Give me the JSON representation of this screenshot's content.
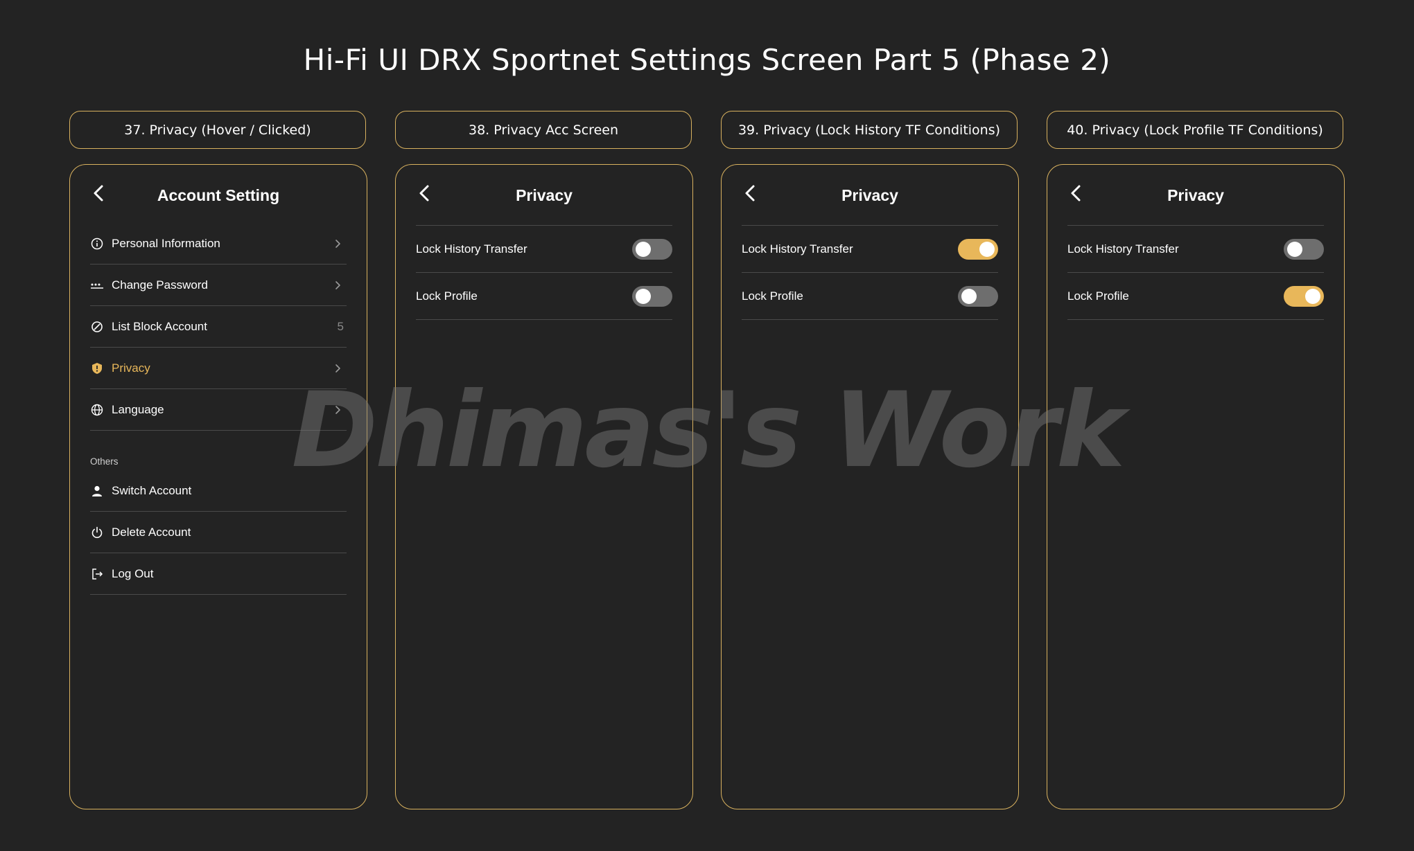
{
  "page_title": "Hi-Fi UI DRX Sportnet Settings Screen Part 5 (Phase 2)",
  "watermark": "Dhimas's Work",
  "colors": {
    "background": "#232323",
    "accent": "#e8b75a",
    "border": "#d9b25f",
    "toggle_off": "#6e6e6e"
  },
  "screens": [
    {
      "label": "37. Privacy (Hover / Clicked)",
      "title": "Account Setting",
      "menu": [
        {
          "label": "Personal Information",
          "icon": "info-circle-icon",
          "trail": "chevron"
        },
        {
          "label": "Change Password",
          "icon": "password-dots-icon",
          "trail": "chevron"
        },
        {
          "label": "List Block Account",
          "icon": "block-icon",
          "trail": "count",
          "count": "5"
        },
        {
          "label": "Privacy",
          "icon": "shield-icon",
          "trail": "chevron",
          "active": true
        },
        {
          "label": "Language",
          "icon": "globe-icon",
          "trail": "chevron"
        }
      ],
      "others_label": "Others",
      "others": [
        {
          "label": "Switch Account",
          "icon": "user-icon"
        },
        {
          "label": "Delete Account",
          "icon": "power-icon"
        },
        {
          "label": "Log Out",
          "icon": "logout-icon"
        }
      ]
    },
    {
      "label": "38. Privacy Acc Screen",
      "title": "Privacy",
      "toggles": [
        {
          "label": "Lock History Transfer",
          "on": false
        },
        {
          "label": "Lock Profile",
          "on": false
        }
      ]
    },
    {
      "label": "39. Privacy (Lock History TF Conditions)",
      "title": "Privacy",
      "toggles": [
        {
          "label": "Lock History Transfer",
          "on": true
        },
        {
          "label": "Lock Profile",
          "on": false
        }
      ]
    },
    {
      "label": "40. Privacy (Lock Profile TF Conditions)",
      "title": "Privacy",
      "toggles": [
        {
          "label": "Lock History Transfer",
          "on": false
        },
        {
          "label": "Lock Profile",
          "on": true
        }
      ]
    }
  ]
}
